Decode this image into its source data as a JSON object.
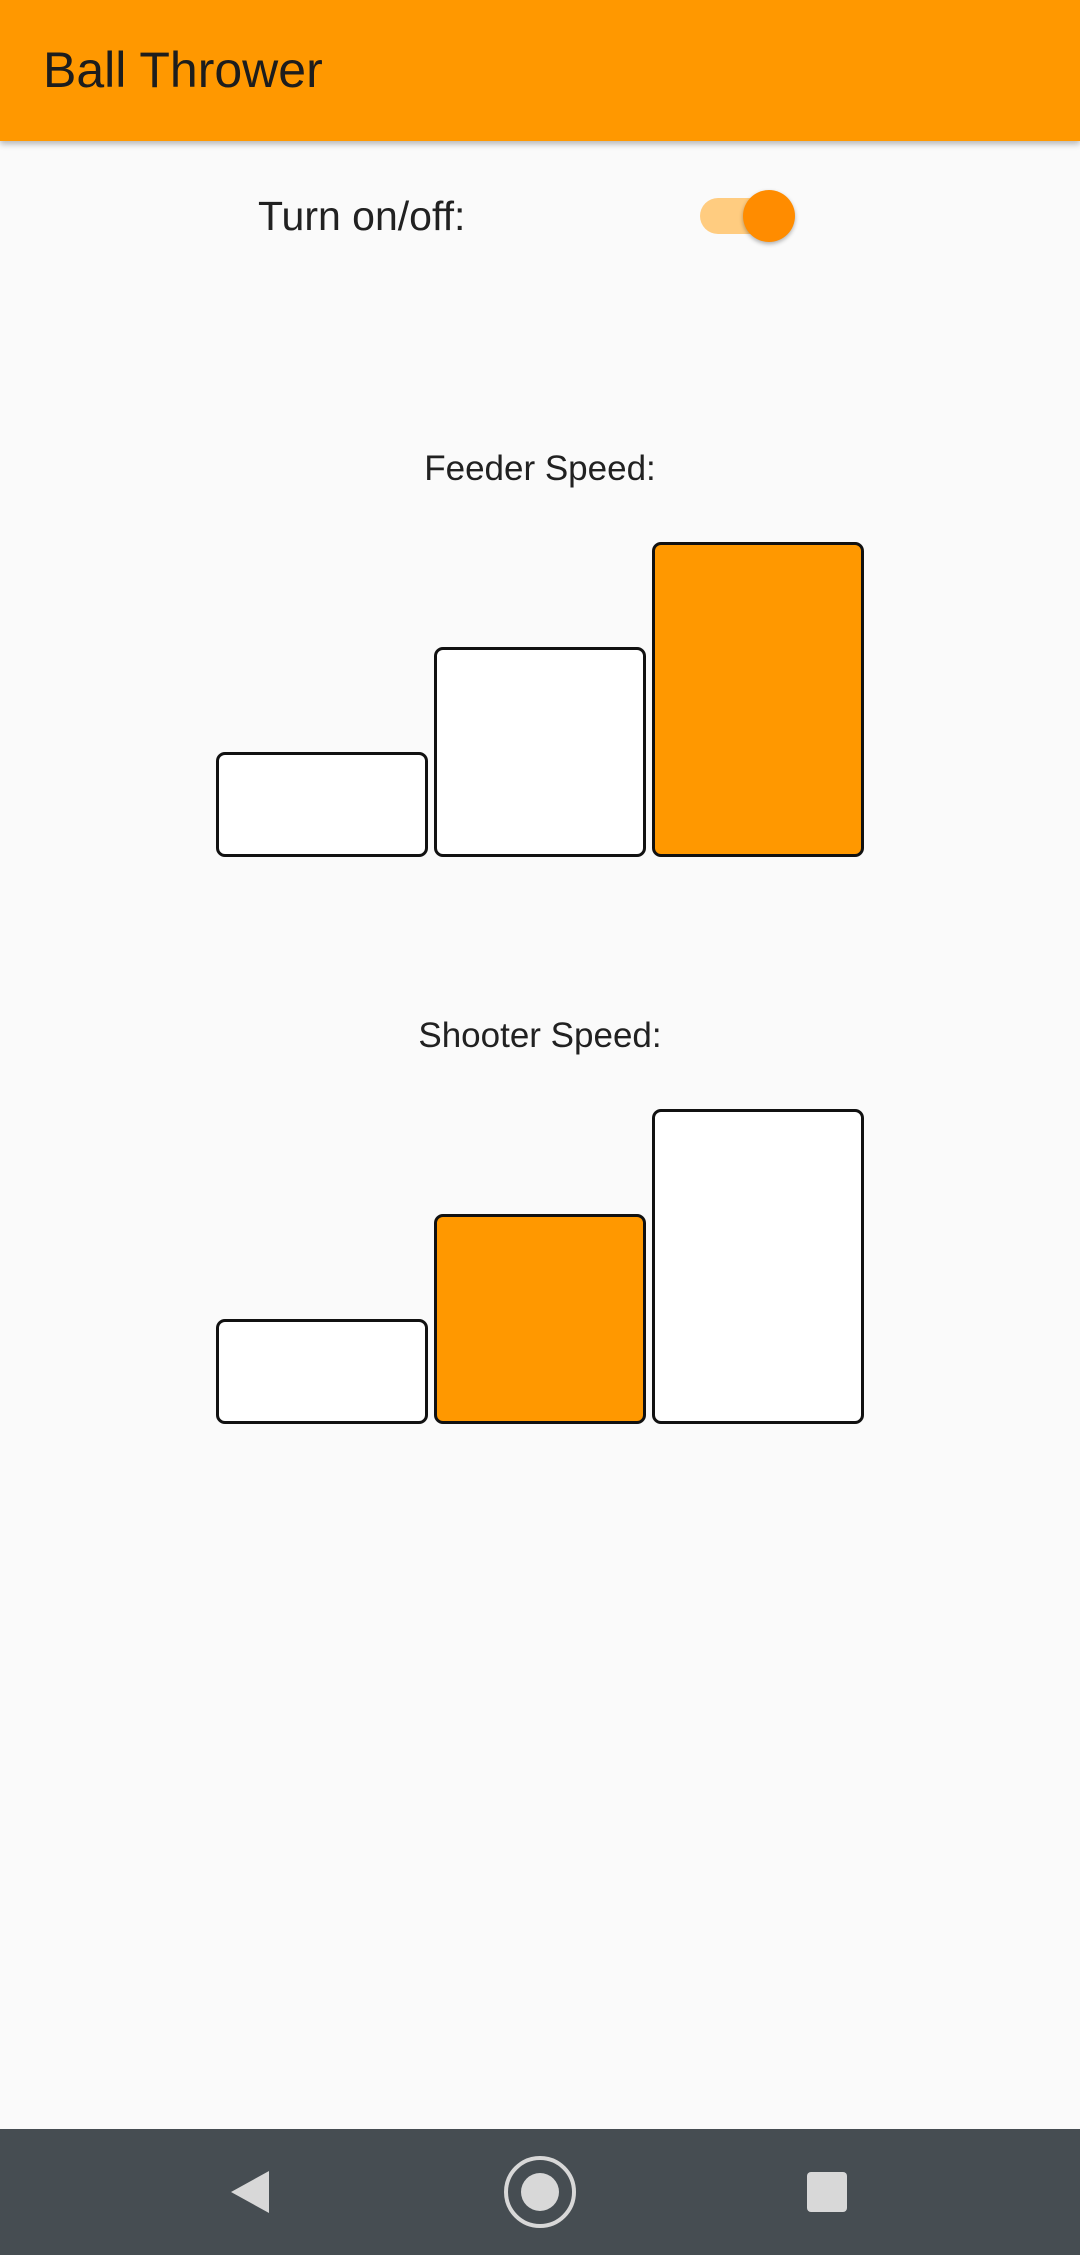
{
  "app_bar": {
    "title": "Ball Thrower",
    "color": "#ff9800"
  },
  "power": {
    "label": "Turn on/off:",
    "state": "on",
    "accent_color": "#ff8c00"
  },
  "feeder": {
    "title": "Feeder Speed:",
    "levels": 3,
    "selected_level": 3
  },
  "shooter": {
    "title": "Shooter Speed:",
    "levels": 3,
    "selected_level": 2
  },
  "colors": {
    "selected_bar": "#ff9800",
    "unselected_bar": "#ffffff",
    "background": "#fafafa",
    "nav_bar": "#464d52"
  },
  "nav": {
    "icons": [
      "back-icon",
      "home-icon",
      "recents-icon"
    ]
  }
}
